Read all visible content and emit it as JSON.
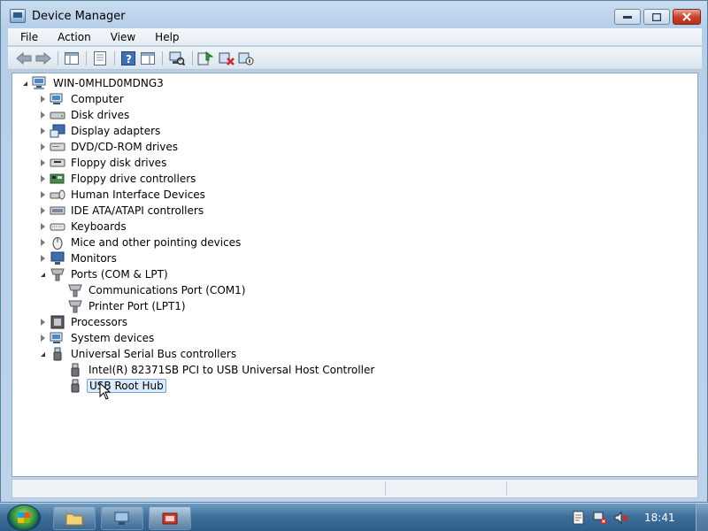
{
  "window": {
    "title": "Device Manager"
  },
  "menu": [
    "File",
    "Action",
    "View",
    "Help"
  ],
  "toolbar": {
    "buttons": [
      "back-icon",
      "forward-icon",
      "show-hide-console-tree-icon",
      "properties-icon",
      "help-icon",
      "show-action-pane-icon",
      "scan-hardware-icon",
      "update-driver-icon",
      "uninstall-icon",
      "disable-icon"
    ]
  },
  "tree": {
    "root": "WIN-0MHLD0MDNG3",
    "categories": [
      {
        "label": "Computer",
        "icon": "computer-icon",
        "expanded": false
      },
      {
        "label": "Disk drives",
        "icon": "disk-drive-icon",
        "expanded": false
      },
      {
        "label": "Display adapters",
        "icon": "display-adapter-icon",
        "expanded": false
      },
      {
        "label": "DVD/CD-ROM drives",
        "icon": "dvd-drive-icon",
        "expanded": false
      },
      {
        "label": "Floppy disk drives",
        "icon": "floppy-drive-icon",
        "expanded": false
      },
      {
        "label": "Floppy drive controllers",
        "icon": "floppy-controller-icon",
        "expanded": false
      },
      {
        "label": "Human Interface Devices",
        "icon": "hid-icon",
        "expanded": false
      },
      {
        "label": "IDE ATA/ATAPI controllers",
        "icon": "ide-controller-icon",
        "expanded": false
      },
      {
        "label": "Keyboards",
        "icon": "keyboard-icon",
        "expanded": false
      },
      {
        "label": "Mice and other pointing devices",
        "icon": "mouse-icon",
        "expanded": false
      },
      {
        "label": "Monitors",
        "icon": "monitor-icon",
        "expanded": false
      },
      {
        "label": "Ports (COM & LPT)",
        "icon": "port-icon",
        "expanded": true,
        "children": [
          "Communications Port (COM1)",
          "Printer Port (LPT1)"
        ]
      },
      {
        "label": "Processors",
        "icon": "processor-icon",
        "expanded": false
      },
      {
        "label": "System devices",
        "icon": "system-device-icon",
        "expanded": false
      },
      {
        "label": "Universal Serial Bus controllers",
        "icon": "usb-icon",
        "expanded": true,
        "children": [
          "Intel(R) 82371SB PCI to USB Universal Host Controller",
          "USB Root Hub"
        ]
      }
    ],
    "selected": "USB Root Hub"
  },
  "taskbar": {
    "clock": "18:41",
    "buttons": [
      "explorer-icon",
      "remote-desktop-icon",
      "device-manager-icon"
    ],
    "tray": [
      "action-center-icon",
      "network-icon",
      "volume-muted-icon"
    ]
  }
}
